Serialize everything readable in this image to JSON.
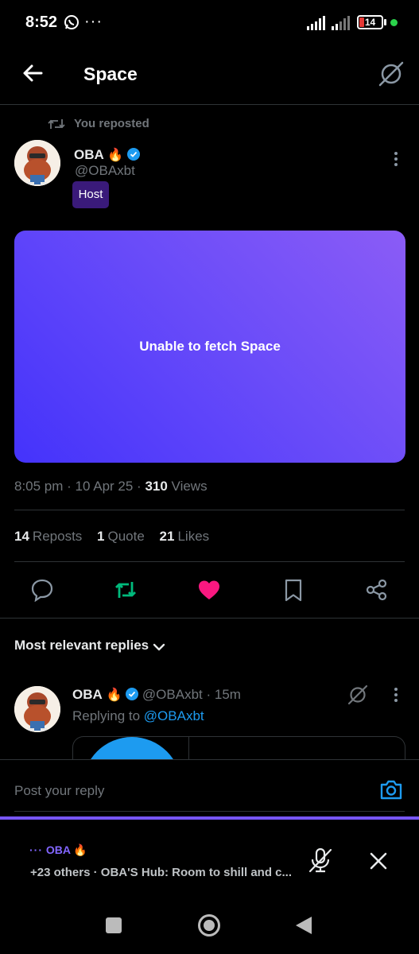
{
  "status_bar": {
    "time": "8:52",
    "battery": "14",
    "more": "···"
  },
  "header": {
    "title": "Space"
  },
  "repost": {
    "label": "You reposted"
  },
  "post": {
    "name": "OBA",
    "emoji": "🔥",
    "handle": "@OBAxbt",
    "badge": "Host",
    "card_text": "Unable to fetch Space",
    "time": "8:05 pm",
    "date": "10 Apr 25",
    "views_count": "310",
    "views_label": "Views",
    "reposts_count": "14",
    "reposts_label": "Reposts",
    "quotes_count": "1",
    "quotes_label": "Quote",
    "likes_count": "21",
    "likes_label": "Likes"
  },
  "replies": {
    "sort_label": "Most relevant replies"
  },
  "reply": {
    "name": "OBA",
    "emoji": "🔥",
    "handle": "@OBAxbt",
    "age": "15m",
    "replying_prefix": "Replying to",
    "replying_handle": "@OBAxbt"
  },
  "compose": {
    "placeholder": "Post your reply"
  },
  "space_dock": {
    "host": "OBA 🔥",
    "title": "+23 others · OBA'S Hub: Room to shill and c..."
  },
  "colors": {
    "accent": "#1d9bf0",
    "repost_green": "#00ba7c",
    "like_pink": "#f91880",
    "space_purple": "#7856ff"
  },
  "icons": [
    "whatsapp-icon",
    "back-arrow-icon",
    "no-connection-icon",
    "repost-icon",
    "verified-icon",
    "more-icon",
    "reply-icon",
    "like-icon",
    "bookmark-icon",
    "share-icon",
    "chevron-down-icon",
    "camera-icon",
    "mic-off-icon",
    "close-icon"
  ]
}
